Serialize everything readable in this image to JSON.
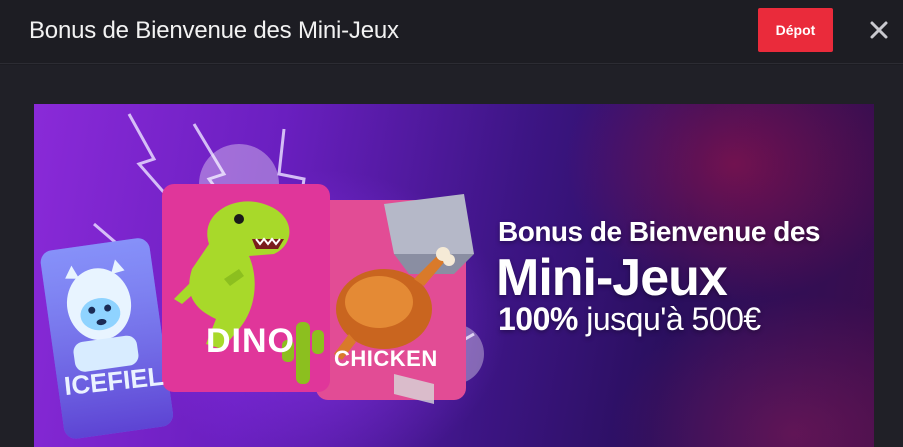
{
  "header": {
    "title": "Bonus de Bienvenue des Mini-Jeux",
    "deposit_label": "Dépot",
    "close_icon": "close-icon"
  },
  "banner": {
    "headline": "Bonus de Bienvenue des",
    "big_title": "Mini-Jeux",
    "offer_percent": "100%",
    "offer_rest": " jusqu'à 500€",
    "cards": {
      "icefield": "ICEFIEL",
      "dino": "DINO",
      "chicken": "CHICKEN"
    }
  },
  "colors": {
    "header_bg": "#1d1d23",
    "deposit_btn": "#ea2b3b",
    "banner_purple": "#6a1fc0",
    "dino_card": "#e0369a",
    "dino_green": "#a8d92a"
  }
}
